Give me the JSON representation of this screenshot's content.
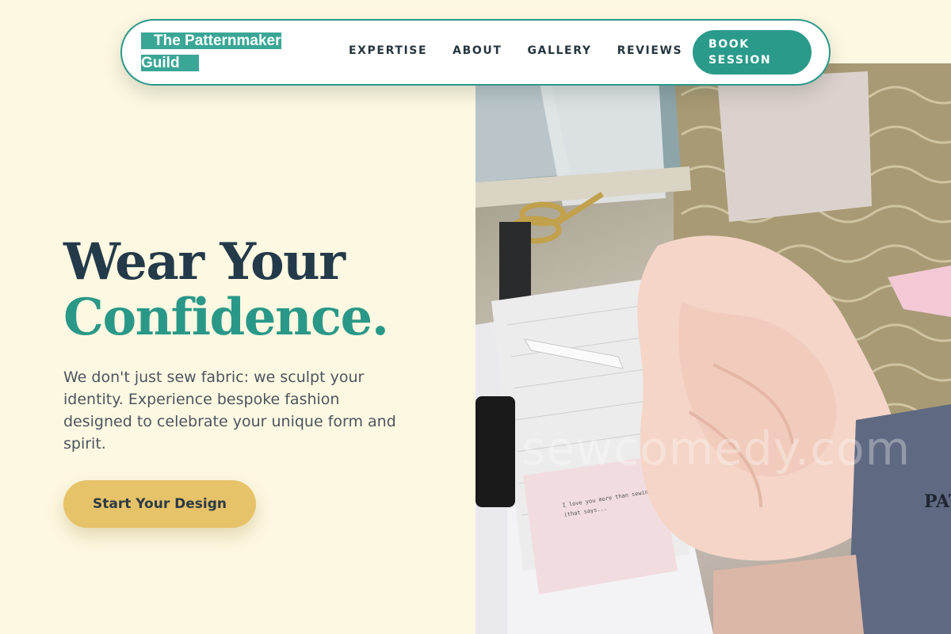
{
  "nav": {
    "logo_line1": "The Patternmaker",
    "logo_line2": "Guild",
    "links": [
      "EXPERTISE",
      "ABOUT",
      "GALLERY",
      "REVIEWS"
    ],
    "book_line1": "BOOK",
    "book_line2": "SESSION"
  },
  "hero": {
    "title_line1": "Wear Your",
    "title_line2": "Confidence.",
    "subtitle": "We don't just sew fabric: we sculpt your identity. Experience bespoke fashion designed to celebrate your unique form and spirit.",
    "cta_label": "Start Your Design"
  },
  "photo": {
    "watermark": "sewcomedy.com",
    "card_text_1": "I love you more than sewin",
    "card_text_2": "(that says...",
    "book_text": "PAT SOU"
  },
  "colors": {
    "background": "#fdf8e1",
    "teal": "#2a9888",
    "navy": "#233a4a",
    "gold": "#e6c269"
  }
}
